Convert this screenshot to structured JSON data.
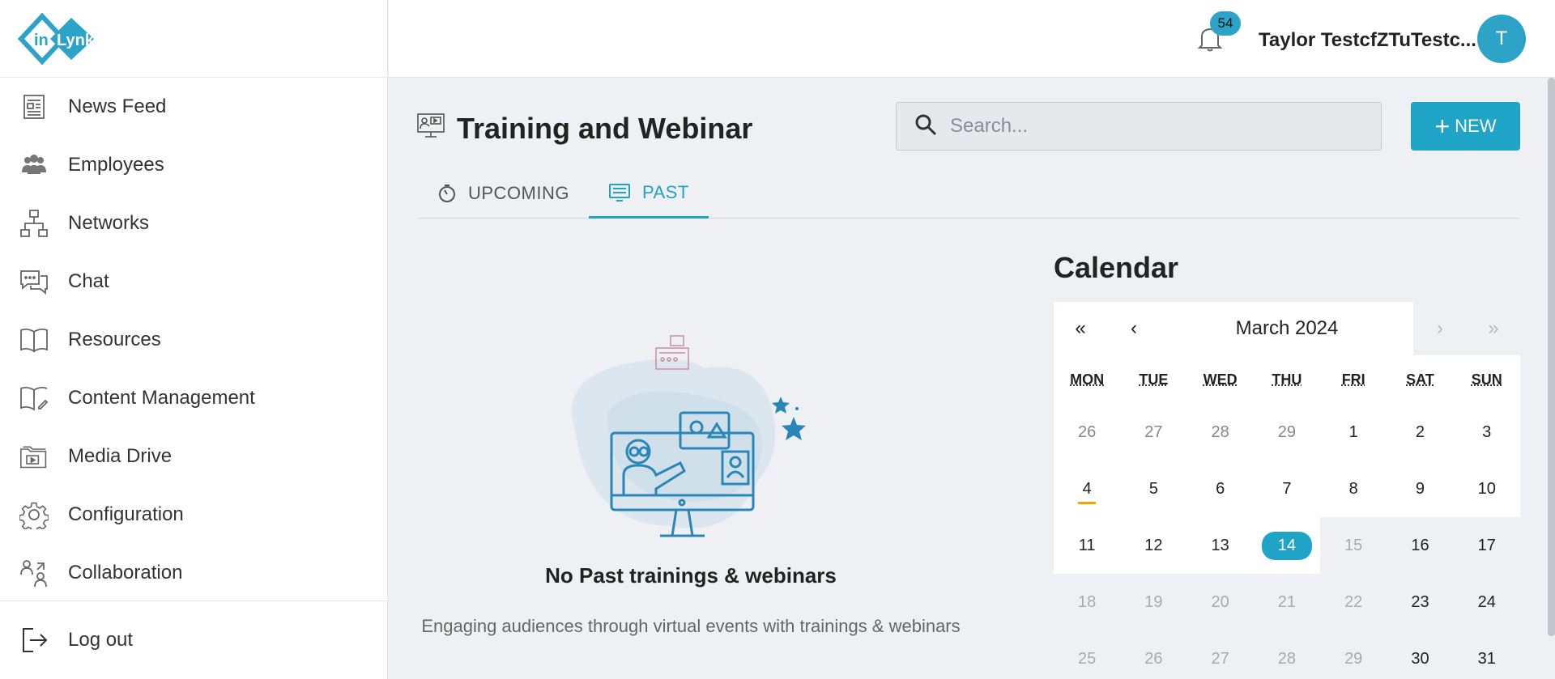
{
  "app": {
    "logo_text": "inLynk"
  },
  "sidebar": {
    "items": [
      {
        "label": "News Feed",
        "icon": "newspaper-icon"
      },
      {
        "label": "Employees",
        "icon": "people-icon"
      },
      {
        "label": "Networks",
        "icon": "network-icon"
      },
      {
        "label": "Chat",
        "icon": "chat-icon"
      },
      {
        "label": "Resources",
        "icon": "book-icon"
      },
      {
        "label": "Content Management",
        "icon": "content-icon"
      },
      {
        "label": "Media Drive",
        "icon": "media-folder-icon"
      },
      {
        "label": "Configuration",
        "icon": "gear-icon"
      },
      {
        "label": "Collaboration",
        "icon": "collaboration-icon"
      }
    ],
    "logout_label": "Log out"
  },
  "header": {
    "notification_count": "54",
    "user_name": "Taylor TestcfZTuTestc...",
    "avatar_initial": "T"
  },
  "page": {
    "title": "Training and Webinar",
    "search_placeholder": "Search...",
    "new_button_label": "NEW",
    "tabs": [
      {
        "label": "UPCOMING",
        "active": false
      },
      {
        "label": "PAST",
        "active": true
      }
    ],
    "empty_title": "No Past trainings & webinars",
    "empty_description": "Engaging audiences through virtual events with trainings & webinars"
  },
  "calendar": {
    "title": "Calendar",
    "month_label": "March 2024",
    "nav": {
      "prev_year": "«",
      "prev_month": "‹",
      "next_month": "›",
      "next_year": "»"
    },
    "weekdays": [
      "MON",
      "TUE",
      "WED",
      "THU",
      "FRI",
      "SAT",
      "SUN"
    ],
    "weeks": [
      [
        "26",
        "27",
        "28",
        "29",
        "1",
        "2",
        "3"
      ],
      [
        "4",
        "5",
        "6",
        "7",
        "8",
        "9",
        "10"
      ],
      [
        "11",
        "12",
        "13",
        "14",
        "15",
        "16",
        "17"
      ],
      [
        "18",
        "19",
        "20",
        "21",
        "22",
        "23",
        "24"
      ],
      [
        "25",
        "26",
        "27",
        "28",
        "29",
        "30",
        "31"
      ]
    ],
    "today": "4",
    "selected": "14"
  },
  "colors": {
    "accent": "#1fa3c6",
    "today_marker": "#f0a500",
    "background": "#eef0f4"
  }
}
